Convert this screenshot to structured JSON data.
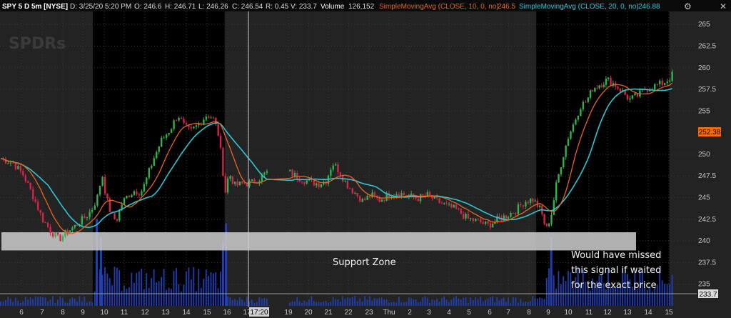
{
  "header": {
    "symbol": "SPY 5 D 5m [NYSE]",
    "date": "D: 3/25/20 5:20 PM",
    "open": "O: 246.6",
    "high": "H: 246.71",
    "low": "L: 246.26",
    "close": "C: 246.54",
    "range": "R: 0.45",
    "val": "V: 233.7",
    "volume_label": "Volume",
    "volume_value": "126,152",
    "sma10_label": "SimpleMovingAvg (CLOSE, 10, 0, no)",
    "sma10_value": "246.5",
    "sma20_label": "SimpleMovingAvg (CLOSE, 20, 0, no)",
    "sma20_value": "246.88"
  },
  "watermark": "SPDRs",
  "colors": {
    "background": "#232323",
    "extended_hours": "#000000",
    "grid": "#3a3a3a",
    "up_candle": "#2fb34a",
    "down_candle": "#d8234a",
    "sma10": "#e8641e",
    "sma20": "#2cc7d4",
    "volume": "#1f3fb3",
    "support_zone": "#c8c8c8",
    "last_price_bg": "#ff6a00",
    "symbol_box": "#606060"
  },
  "annotations": {
    "support_zone": "Support Zone",
    "missed_signal": [
      "Would have missed",
      "this signal if waited",
      "for the exact price"
    ]
  },
  "cursor_time_label": "17:20",
  "chart_data": {
    "type": "candlestick",
    "title": "SPY 5 D 5m [NYSE]",
    "ylim": [
      232.5,
      266.5
    ],
    "y_ticks": [
      265,
      262.5,
      260,
      257.5,
      255,
      250,
      247.5,
      245,
      242.5,
      240,
      237.5,
      235
    ],
    "last_price": 252.38,
    "volume_last": 233.7,
    "x_tick_labels": [
      "6",
      "7",
      "8",
      "9",
      "10",
      "11",
      "12",
      "13",
      "14",
      "15",
      "16",
      "17",
      "19",
      "20",
      "21",
      "22",
      "23",
      "Thu",
      "2",
      "3",
      "4",
      "5",
      "6",
      "7",
      "8",
      "9",
      "10",
      "11",
      "12",
      "13",
      "14",
      "15"
    ],
    "support_zone": {
      "low": 238.9,
      "high": 241.0,
      "label": "Support Zone"
    },
    "sessions": [
      {
        "name": "extended hours",
        "from_tick": "9",
        "to_tick": "16"
      },
      {
        "name": "extended hours",
        "from_tick": "9",
        "to_tick": "15"
      }
    ],
    "price_path": [
      {
        "x": 5.0,
        "y": 249.5
      },
      {
        "x": 5.6,
        "y": 249.0
      },
      {
        "x": 6.1,
        "y": 247.6
      },
      {
        "x": 6.6,
        "y": 245.0
      },
      {
        "x": 7.0,
        "y": 242.6
      },
      {
        "x": 7.4,
        "y": 241.2
      },
      {
        "x": 7.8,
        "y": 240.2
      },
      {
        "x": 8.2,
        "y": 241.0
      },
      {
        "x": 8.6,
        "y": 241.7
      },
      {
        "x": 9.0,
        "y": 242.5
      },
      {
        "x": 9.4,
        "y": 243.5
      },
      {
        "x": 9.7,
        "y": 245.2
      },
      {
        "x": 9.9,
        "y": 247.8
      },
      {
        "x": 10.1,
        "y": 245.0
      },
      {
        "x": 10.35,
        "y": 243.0
      },
      {
        "x": 10.6,
        "y": 242.3
      },
      {
        "x": 10.9,
        "y": 244.4
      },
      {
        "x": 11.2,
        "y": 245.3
      },
      {
        "x": 11.5,
        "y": 245.8
      },
      {
        "x": 11.8,
        "y": 245.6
      },
      {
        "x": 12.0,
        "y": 246.6
      },
      {
        "x": 12.4,
        "y": 249.4
      },
      {
        "x": 12.8,
        "y": 251.6
      },
      {
        "x": 13.2,
        "y": 252.8
      },
      {
        "x": 13.6,
        "y": 254.6
      },
      {
        "x": 13.9,
        "y": 253.2
      },
      {
        "x": 14.2,
        "y": 252.6
      },
      {
        "x": 14.6,
        "y": 253.5
      },
      {
        "x": 15.0,
        "y": 254.6
      },
      {
        "x": 15.3,
        "y": 254.2
      },
      {
        "x": 15.55,
        "y": 252.5
      },
      {
        "x": 15.75,
        "y": 249.2
      },
      {
        "x": 15.9,
        "y": 245.5
      },
      {
        "x": 16.1,
        "y": 247.8
      },
      {
        "x": 16.4,
        "y": 246.4
      },
      {
        "x": 16.8,
        "y": 246.6
      },
      {
        "x": 17.2,
        "y": 246.7
      },
      {
        "x": 17.6,
        "y": 247.2
      },
      {
        "x": 18.0,
        "y": 248.0
      },
      {
        "x": 18.5,
        "y": 247.3
      },
      {
        "x": 19.0,
        "y": 246.9
      },
      {
        "x": 19.5,
        "y": 246.6
      },
      {
        "x": 19.9,
        "y": 247.0
      },
      {
        "x": 20.2,
        "y": 249.0
      },
      {
        "x": 20.5,
        "y": 248.2
      },
      {
        "x": 20.9,
        "y": 246.6
      },
      {
        "x": 21.3,
        "y": 245.6
      },
      {
        "x": 21.7,
        "y": 244.6
      },
      {
        "x": 22.1,
        "y": 245.3
      },
      {
        "x": 22.5,
        "y": 244.7
      },
      {
        "x": 22.9,
        "y": 245.2
      },
      {
        "x": 23.4,
        "y": 245.6
      },
      {
        "x": 23.9,
        "y": 245.2
      },
      {
        "x": 24.4,
        "y": 244.9
      },
      {
        "x": 24.9,
        "y": 245.3
      },
      {
        "x": 25.4,
        "y": 244.6
      },
      {
        "x": 25.9,
        "y": 244.0
      },
      {
        "x": 26.4,
        "y": 243.6
      },
      {
        "x": 26.9,
        "y": 242.6
      },
      {
        "x": 27.4,
        "y": 242.3
      },
      {
        "x": 27.9,
        "y": 241.8
      },
      {
        "x": 28.4,
        "y": 242.4
      },
      {
        "x": 28.9,
        "y": 242.9
      },
      {
        "x": 29.4,
        "y": 243.6
      },
      {
        "x": 29.8,
        "y": 244.6
      },
      {
        "x": 30.2,
        "y": 244.8
      },
      {
        "x": 30.6,
        "y": 243.6
      },
      {
        "x": 30.9,
        "y": 241.3
      },
      {
        "x": 31.15,
        "y": 243.0
      },
      {
        "x": 31.4,
        "y": 246.4
      },
      {
        "x": 31.7,
        "y": 249.5
      },
      {
        "x": 32.0,
        "y": 252.0
      },
      {
        "x": 32.3,
        "y": 253.8
      },
      {
        "x": 32.6,
        "y": 255.6
      },
      {
        "x": 32.9,
        "y": 256.2
      },
      {
        "x": 33.2,
        "y": 257.6
      },
      {
        "x": 33.6,
        "y": 258.1
      },
      {
        "x": 34.0,
        "y": 258.6
      },
      {
        "x": 34.4,
        "y": 258.0
      },
      {
        "x": 34.8,
        "y": 257.1
      },
      {
        "x": 35.1,
        "y": 256.3
      },
      {
        "x": 35.5,
        "y": 256.8
      },
      {
        "x": 35.9,
        "y": 257.6
      },
      {
        "x": 36.3,
        "y": 257.9
      },
      {
        "x": 36.7,
        "y": 258.2
      },
      {
        "x": 37.0,
        "y": 258.7
      },
      {
        "x": 37.25,
        "y": 259.4
      }
    ],
    "volume_spikes": [
      {
        "x": 9.65,
        "value": 0.95
      },
      {
        "x": 9.85,
        "value": 0.75
      },
      {
        "x": 15.8,
        "value": 0.7
      },
      {
        "x": 15.95,
        "value": 0.9
      },
      {
        "x": 31.15,
        "value": 0.75
      }
    ]
  }
}
